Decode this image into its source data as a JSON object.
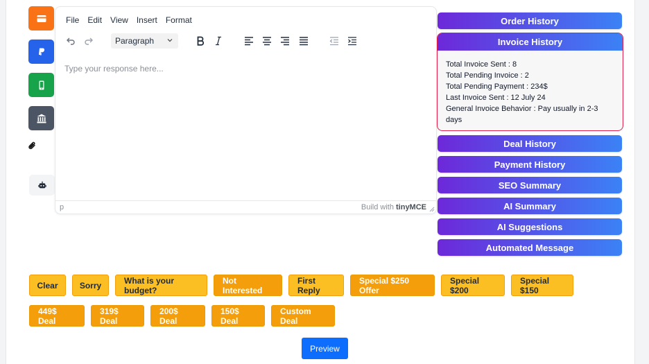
{
  "side": {
    "icons": [
      "credit-card-icon",
      "paypal-icon",
      "mobile-icon",
      "bank-icon",
      "paperclip-icon",
      "robot-icon"
    ],
    "colors": {
      "card": "#f97316",
      "paypal": "#2563eb",
      "mobile": "#16a34a",
      "bank": "#4b5563"
    }
  },
  "editor": {
    "menu": [
      "File",
      "Edit",
      "View",
      "Insert",
      "Format"
    ],
    "format_value": "Paragraph",
    "placeholder": "Type your response here...",
    "path": "p",
    "brand_prefix": "Build with",
    "brand_name": "tinyMCE"
  },
  "panel": {
    "order_history": "Order History",
    "invoice_history": "Invoice History",
    "invoice_lines": [
      "Total Invoice Sent : 8",
      "Total Pending Invoice : 2",
      "Total Pending Payment : 234$",
      "Last Invoice Sent : 12 July 24",
      "General Invoice Behavior : Pay usually in 2-3 days"
    ],
    "deal_history": "Deal History",
    "payment_history": "Payment History",
    "seo_summary": "SEO Summary",
    "ai_summary": "AI Summary",
    "ai_suggestions": "AI Suggestions",
    "automated_message": "Automated Message"
  },
  "quick": {
    "row1": [
      "Clear",
      "Sorry",
      "What is your budget?",
      "Not Interested",
      "First Reply",
      "Special $250 Offer",
      "Special $200",
      "Special $150"
    ],
    "row2": [
      "449$ Deal",
      "319$ Deal",
      "200$ Deal",
      "150$ Deal",
      "Custom Deal"
    ],
    "preview": "Preview"
  }
}
